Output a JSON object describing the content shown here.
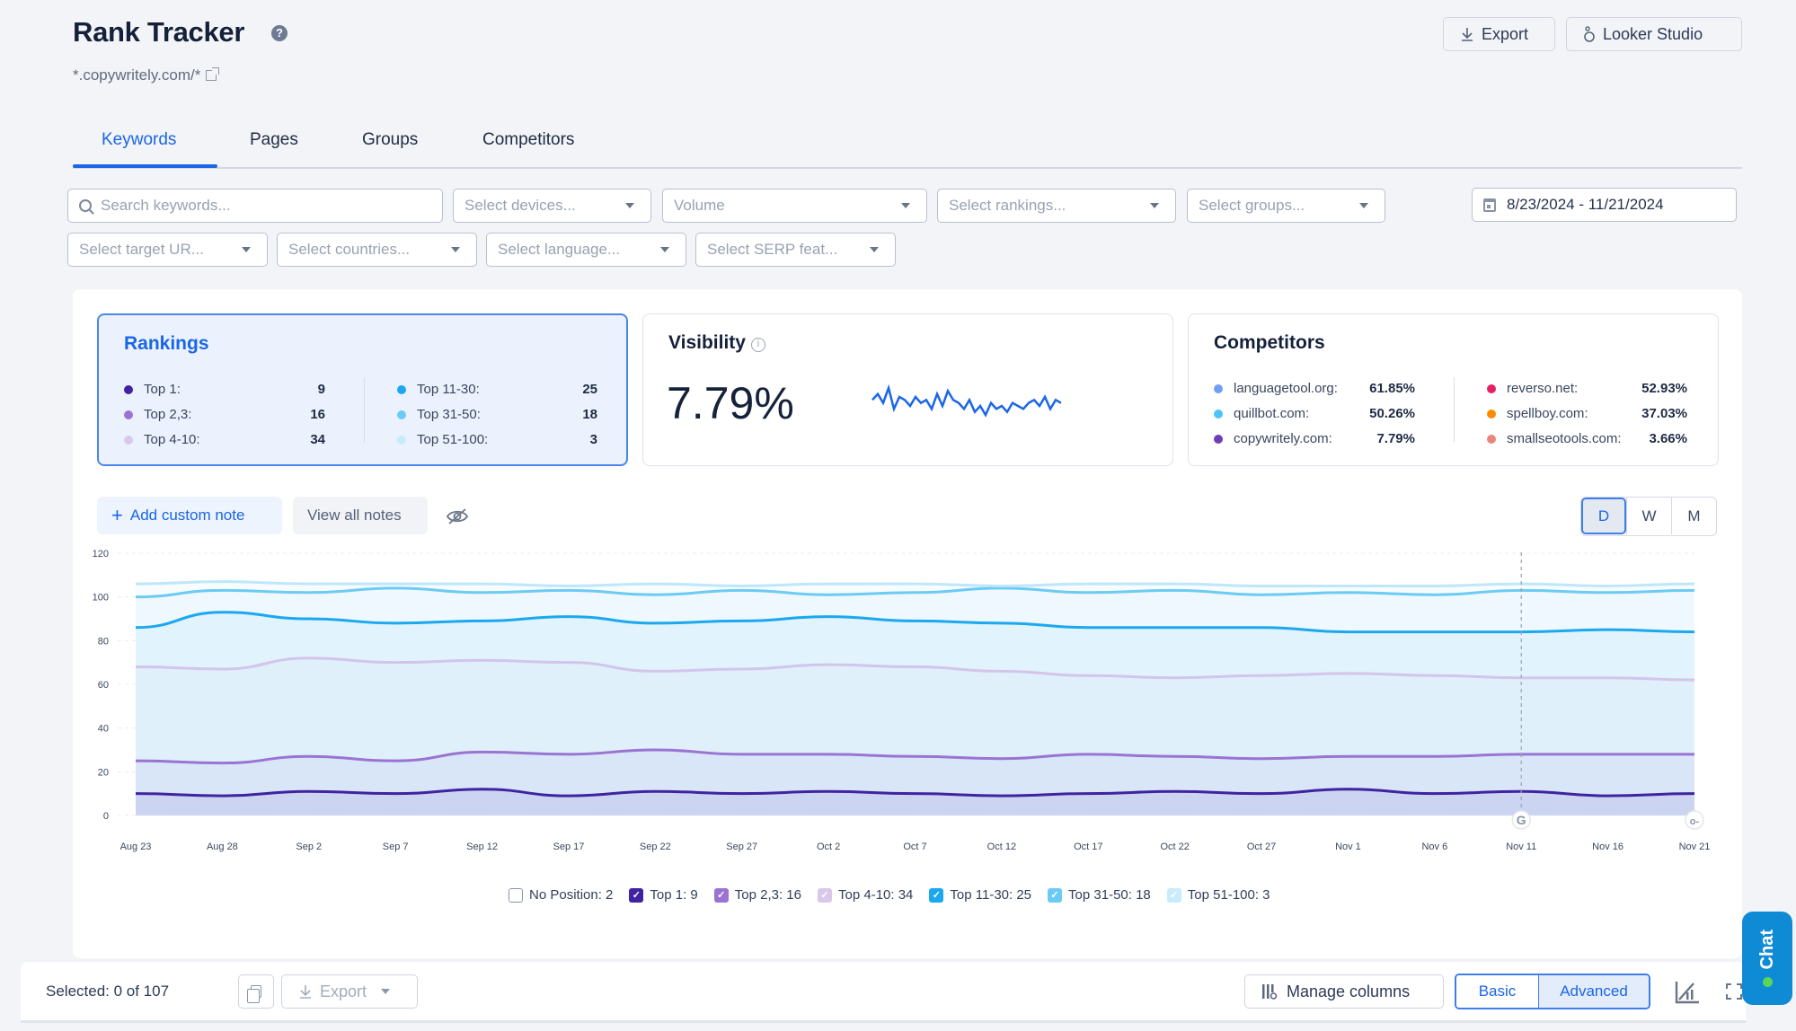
{
  "header": {
    "title": "Rank Tracker",
    "help_icon": "?",
    "domain": "*.copywritely.com/*",
    "export_label": "Export",
    "looker_label": "Looker Studio"
  },
  "tabs": [
    {
      "label": "Keywords",
      "active": true
    },
    {
      "label": "Pages",
      "active": false
    },
    {
      "label": "Groups",
      "active": false
    },
    {
      "label": "Competitors",
      "active": false
    }
  ],
  "filters": {
    "search_placeholder": "Search keywords...",
    "devices": "Select devices...",
    "volume": "Volume",
    "rankings": "Select rankings...",
    "groups": "Select groups...",
    "date_range": "8/23/2024 - 11/21/2024",
    "target_url": "Select target UR...",
    "countries": "Select countries...",
    "language": "Select language...",
    "serp": "Select SERP feat..."
  },
  "rankings_card": {
    "title": "Rankings",
    "left": [
      {
        "label": "Top 1:",
        "value": "9",
        "color": "#3f23a0"
      },
      {
        "label": "Top 2,3:",
        "value": "16",
        "color": "#9b73d3"
      },
      {
        "label": "Top 4-10:",
        "value": "34",
        "color": "#d9c8ea"
      }
    ],
    "right": [
      {
        "label": "Top 11-30:",
        "value": "25",
        "color": "#1ba8ef"
      },
      {
        "label": "Top 31-50:",
        "value": "18",
        "color": "#6ccbf4"
      },
      {
        "label": "Top 51-100:",
        "value": "3",
        "color": "#c8ecfb"
      }
    ]
  },
  "visibility_card": {
    "title": "Visibility",
    "value": "7.79%",
    "sparkline_color": "#1a66e8",
    "sparkline": [
      7.9,
      8.1,
      7.8,
      8.3,
      7.6,
      8.0,
      7.9,
      7.7,
      8.0,
      7.8,
      7.9,
      7.6,
      8.1,
      7.7,
      8.2,
      7.9,
      7.8,
      7.6,
      7.9,
      7.5,
      7.7,
      7.4,
      7.8,
      7.6,
      7.7,
      7.5,
      7.8,
      7.7,
      7.6,
      7.8,
      7.9,
      7.7,
      8.0,
      7.6,
      7.9,
      7.8
    ]
  },
  "competitors_card": {
    "title": "Competitors",
    "left": [
      {
        "label": "languagetool.org:",
        "value": "61.85%",
        "color": "#6f9ef5"
      },
      {
        "label": "quillbot.com:",
        "value": "50.26%",
        "color": "#4fc3f7"
      },
      {
        "label": "copywritely.com:",
        "value": "7.79%",
        "color": "#6a3fb8"
      }
    ],
    "right": [
      {
        "label": "reverso.net:",
        "value": "52.93%",
        "color": "#e91e63"
      },
      {
        "label": "spellboy.com:",
        "value": "37.03%",
        "color": "#fb8c00"
      },
      {
        "label": "smallseotools.com:",
        "value": "3.66%",
        "color": "#e8867a"
      }
    ]
  },
  "notes": {
    "add_label": "Add custom note",
    "view_label": "View all notes"
  },
  "granularity": [
    {
      "label": "D",
      "active": true
    },
    {
      "label": "W",
      "active": false
    },
    {
      "label": "M",
      "active": false
    }
  ],
  "chart_data": {
    "type": "area",
    "title": "",
    "xlabel": "",
    "ylabel": "",
    "ylim": [
      0,
      120
    ],
    "yticks": [
      0,
      20,
      40,
      60,
      80,
      100,
      120
    ],
    "grid": true,
    "x": [
      "Aug 23",
      "Aug 28",
      "Sep 2",
      "Sep 7",
      "Sep 12",
      "Sep 17",
      "Sep 22",
      "Sep 27",
      "Oct 2",
      "Oct 7",
      "Oct 12",
      "Oct 17",
      "Oct 22",
      "Oct 27",
      "Nov 1",
      "Nov 6",
      "Nov 11",
      "Nov 16",
      "Nov 21"
    ],
    "legend_position": "bottom",
    "annotations": [
      {
        "x": "Nov 11",
        "label": "G",
        "type": "google-update-marker"
      },
      {
        "x": "Nov 21",
        "label": "key",
        "type": "key-marker"
      }
    ],
    "series": [
      {
        "name": "Top 1",
        "color": "#3f23a0",
        "fill": "#cbd4f0",
        "values": [
          10,
          9,
          11,
          10,
          12,
          9,
          11,
          10,
          11,
          10,
          9,
          10,
          11,
          10,
          12,
          10,
          11,
          9,
          10
        ]
      },
      {
        "name": "Top 2,3",
        "color": "#9b73d3",
        "fill": "#d8e6f8",
        "values": [
          25,
          24,
          27,
          25,
          29,
          28,
          30,
          28,
          28,
          27,
          26,
          28,
          27,
          26,
          27,
          27,
          28,
          28,
          28
        ]
      },
      {
        "name": "Top 4-10",
        "color": "#d4c4ea",
        "fill": "#dff0fb",
        "values": [
          68,
          67,
          72,
          70,
          71,
          70,
          66,
          67,
          69,
          68,
          66,
          64,
          63,
          64,
          65,
          64,
          63,
          63,
          62
        ]
      },
      {
        "name": "Top 11-30",
        "color": "#1ba8ef",
        "fill": "#e1f3fc",
        "values": [
          86,
          93,
          90,
          88,
          89,
          91,
          88,
          89,
          91,
          89,
          88,
          86,
          86,
          86,
          84,
          84,
          84,
          85,
          84
        ]
      },
      {
        "name": "Top 31-50",
        "color": "#6ccbf4",
        "fill": "#eef8fe",
        "values": [
          100,
          103,
          102,
          104,
          102,
          103,
          101,
          103,
          101,
          102,
          104,
          102,
          103,
          101,
          102,
          101,
          103,
          102,
          103
        ]
      },
      {
        "name": "Top 51-100",
        "color": "#bfe6fb",
        "fill": "#f7fcff",
        "values": [
          106,
          107,
          106,
          106,
          106,
          105,
          106,
          105,
          106,
          106,
          105,
          106,
          106,
          105,
          105,
          105,
          106,
          105,
          106
        ]
      }
    ]
  },
  "legend": [
    {
      "label": "No Position: 2",
      "checked": false,
      "color": "#ffffff"
    },
    {
      "label": "Top 1: 9",
      "checked": true,
      "color": "#3f23a0"
    },
    {
      "label": "Top 2,3: 16",
      "checked": true,
      "color": "#9b73d3"
    },
    {
      "label": "Top 4-10: 34",
      "checked": true,
      "color": "#d9c8ea"
    },
    {
      "label": "Top 11-30: 25",
      "checked": true,
      "color": "#1ba8ef"
    },
    {
      "label": "Top 31-50: 18",
      "checked": true,
      "color": "#6ccbf4"
    },
    {
      "label": "Top 51-100: 3",
      "checked": true,
      "color": "#c8ecfb"
    }
  ],
  "bottombar": {
    "selected": "Selected: 0 of 107",
    "export_label": "Export",
    "manage_label": "Manage columns",
    "basic_label": "Basic",
    "advanced_label": "Advanced"
  },
  "chat": {
    "label": "Chat"
  }
}
